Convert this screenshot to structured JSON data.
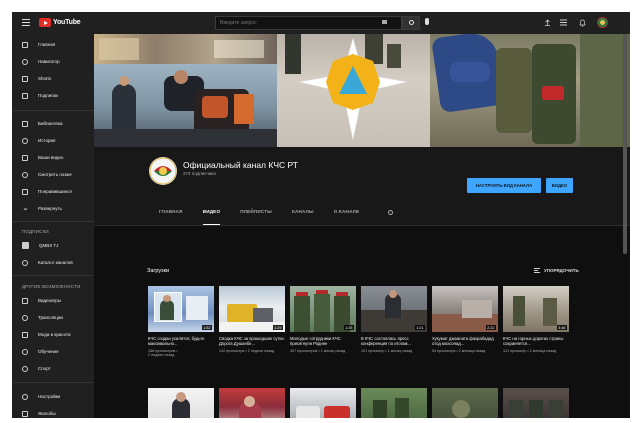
{
  "colors": {
    "brand_red": "#e52d27",
    "accent_blue": "#3ea6ff",
    "bg": "#181818",
    "sidebar_bg": "#202020"
  },
  "topbar": {
    "logo_text": "YouTube",
    "search_placeholder": "Введите запрос",
    "icons": [
      "menu-icon",
      "search-icon",
      "mic-icon",
      "upload-icon",
      "apps-icon",
      "bell-icon"
    ]
  },
  "sidebar": {
    "main": [
      {
        "label": "Главная",
        "icon": "home-icon"
      },
      {
        "label": "Навигатор",
        "icon": "compass-icon"
      },
      {
        "label": "Shorts",
        "icon": "shorts-icon"
      },
      {
        "label": "Подписки",
        "icon": "subscriptions-icon"
      }
    ],
    "library": [
      {
        "label": "Библиотека",
        "icon": "library-icon"
      },
      {
        "label": "История",
        "icon": "history-icon"
      },
      {
        "label": "Ваши видео",
        "icon": "your-videos-icon"
      },
      {
        "label": "Смотреть позже",
        "icon": "watch-later-icon"
      },
      {
        "label": "Понравившиеся",
        "icon": "like-icon"
      },
      {
        "label": "Развернуть",
        "icon": "chevron-down-icon"
      }
    ],
    "subs_heading": "ПОДПИСКИ",
    "subs": [
      {
        "label": "QMBX TJ",
        "icon": "avatar"
      },
      {
        "label": "Каталог каналов",
        "icon": "plus-circle-icon"
      }
    ],
    "more_heading": "ДРУГИЕ ВОЗМОЖНОСТИ",
    "more": [
      {
        "label": "Видеоигры",
        "icon": "gaming-icon"
      },
      {
        "label": "Трансляции",
        "icon": "live-icon"
      },
      {
        "label": "Мода и красота",
        "icon": "fashion-icon"
      },
      {
        "label": "Обучение",
        "icon": "learning-icon"
      },
      {
        "label": "Спорт",
        "icon": "trophy-icon"
      }
    ],
    "bottom": [
      {
        "label": "Настройки",
        "icon": "gear-icon"
      },
      {
        "label": "Жалобы",
        "icon": "flag-icon"
      }
    ]
  },
  "channel": {
    "name": "Официальный канал КЧС РТ",
    "subscribers": "273 подписчика",
    "customize_button": "НАСТРОИТЬ ВИД КАНАЛА",
    "video_button": "ВИДЕО",
    "tabs": [
      "ГЛАВНАЯ",
      "ВИДЕО",
      "ПЛЕЙЛИСТЫ",
      "КАНАЛЫ",
      "О КАНАЛЕ"
    ],
    "active_tab": "ВИДЕО"
  },
  "content": {
    "section_title": "Загрузки",
    "sort_label": "УПОРЯДОЧИТЬ",
    "videos": [
      {
        "title": "КЧС создан усилятся, будьте максимально...",
        "duration": "1:52",
        "meta1": "158 просмотров •",
        "meta2": "2 недели назад"
      },
      {
        "title": "Сводка КЧС за прошедшие сутки. Дорога Душанбе...",
        "duration": "1:29",
        "meta1": "142 просмотра • 2 недели назад",
        "meta2": ""
      },
      {
        "title": "Молодые сотрудники КЧС присягнули Родине",
        "duration": "1:25",
        "meta1": "407 просмотров • 1 месяц назад",
        "meta2": ""
      },
      {
        "title": "В КЧС состоялась пресс конференция по итогам...",
        "duration": "1:21",
        "meta1": "101 просмотр • 1 месяц назад",
        "meta2": ""
      },
      {
        "title": "Хукумат джамоата фахрабадад отод мохсонад...",
        "duration": "2:22",
        "meta1": "54 просмотра • 2 месяца назад",
        "meta2": ""
      },
      {
        "title": "КЧС на горных дорогах страны сохраняется...",
        "duration": "3:46",
        "meta1": "121 просмотр • 2 месяца назад",
        "meta2": ""
      }
    ]
  }
}
